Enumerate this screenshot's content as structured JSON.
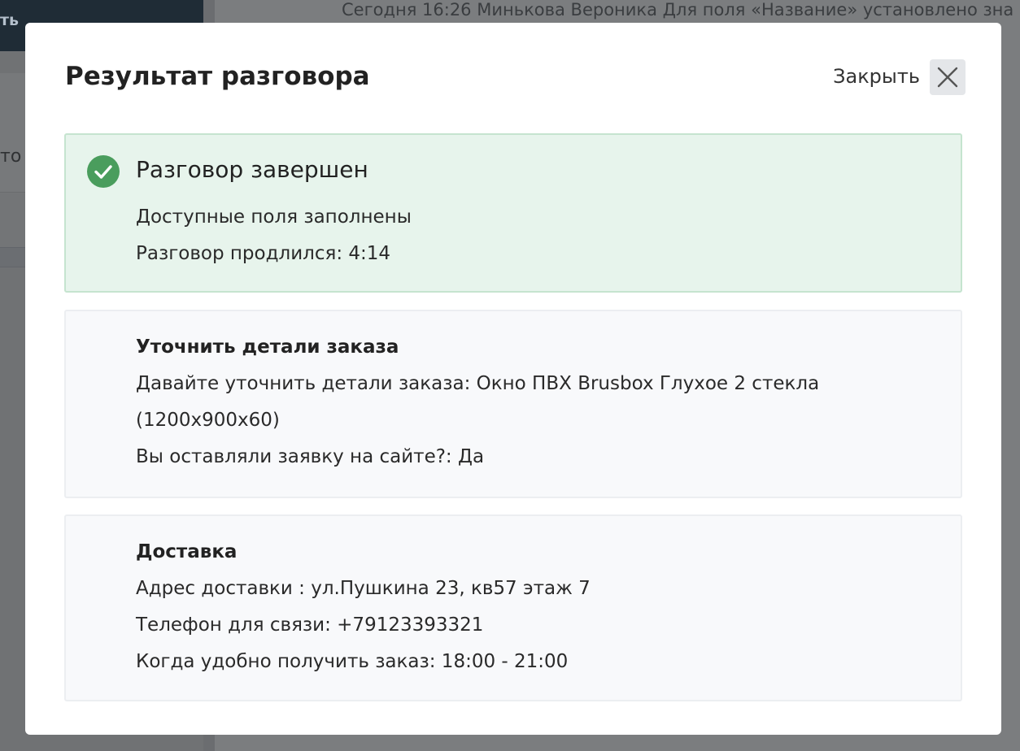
{
  "background": {
    "topbar_text": "ть",
    "panel_text": "то с",
    "log_text": "Сегодня 16:26 Минькова Вероника Для поля «Название» установлено зна"
  },
  "modal": {
    "title": "Результат разговора",
    "close_label": "Закрыть",
    "close_icon": "close-icon",
    "status": {
      "icon": "check-circle-icon",
      "color": "#4a9d5d",
      "title": "Разговор завершен",
      "lines": [
        "Доступные поля заполнены",
        "Разговор продлился: 4:14"
      ]
    },
    "sections": [
      {
        "heading": "Уточнить детали заказа",
        "lines": [
          "Давайте уточнить детали заказа: Окно ПВХ Brusbox Глухое 2 стекла (1200x900x60)",
          "Вы оставляли заявку на сайте?: Да"
        ]
      },
      {
        "heading": "Доставка",
        "lines": [
          "Адрес доставки : ул.Пушкина 23, кв57 этаж 7",
          "Телефон для связи: +79123393321",
          "Когда удобно получить заказ: 18:00 - 21:00"
        ]
      }
    ]
  }
}
